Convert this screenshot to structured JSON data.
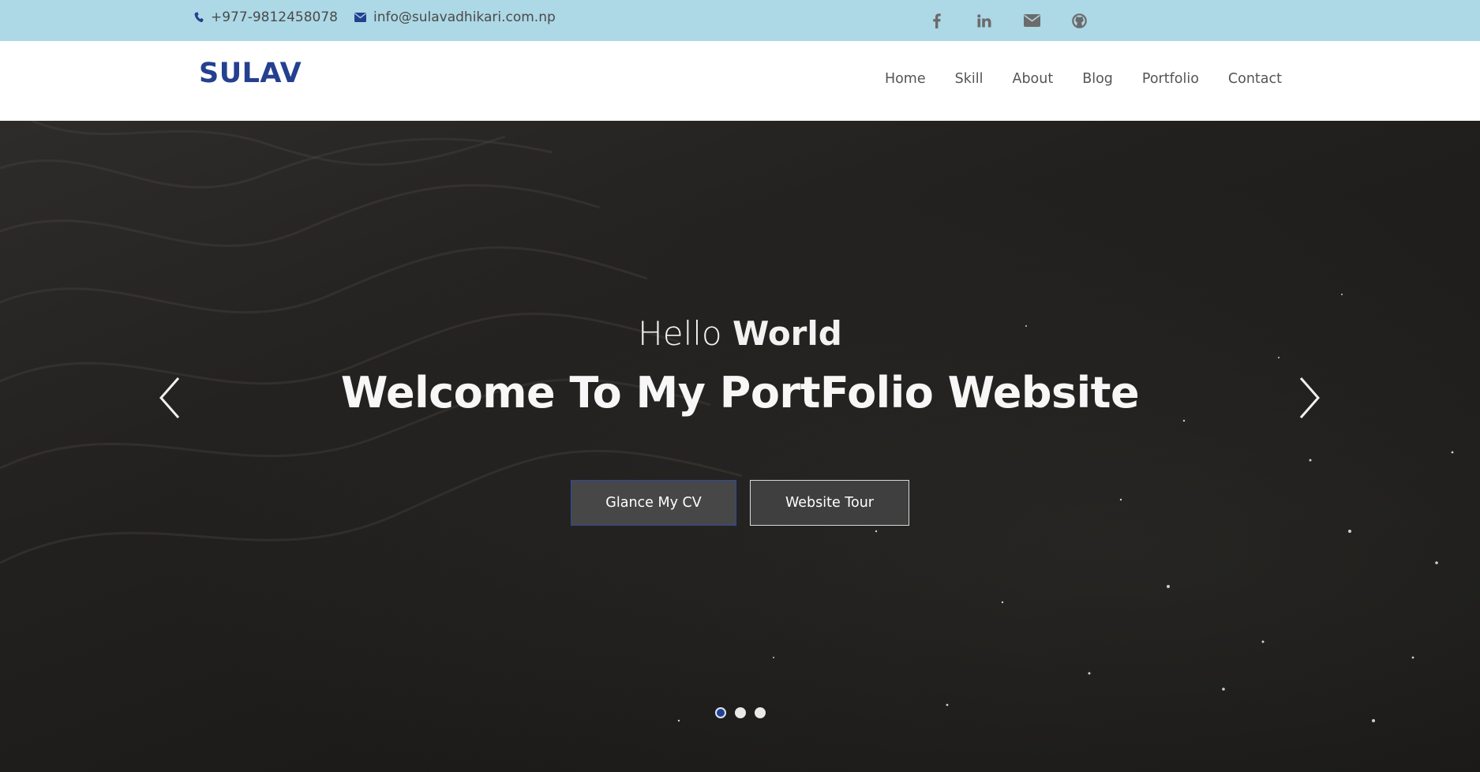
{
  "topbar": {
    "phone": "+977-9812458078",
    "email": "info@sulavadhikari.com.np",
    "background": "#add8e6",
    "social_icons": [
      "facebook-icon",
      "linkedin-icon",
      "envelope-icon",
      "github-icon"
    ]
  },
  "header": {
    "logo": "SULAV",
    "logo_color": "#25408f",
    "nav": [
      "Home",
      "Skill",
      "About",
      "Blog",
      "Portfolio",
      "Contact"
    ]
  },
  "hero": {
    "subtitle_light": "Hello",
    "subtitle_bold": "World",
    "title": "Welcome To My PortFolio Website",
    "buttons": [
      "Glance My CV",
      "Website Tour"
    ],
    "slides": {
      "count": 3,
      "active": 1
    }
  }
}
